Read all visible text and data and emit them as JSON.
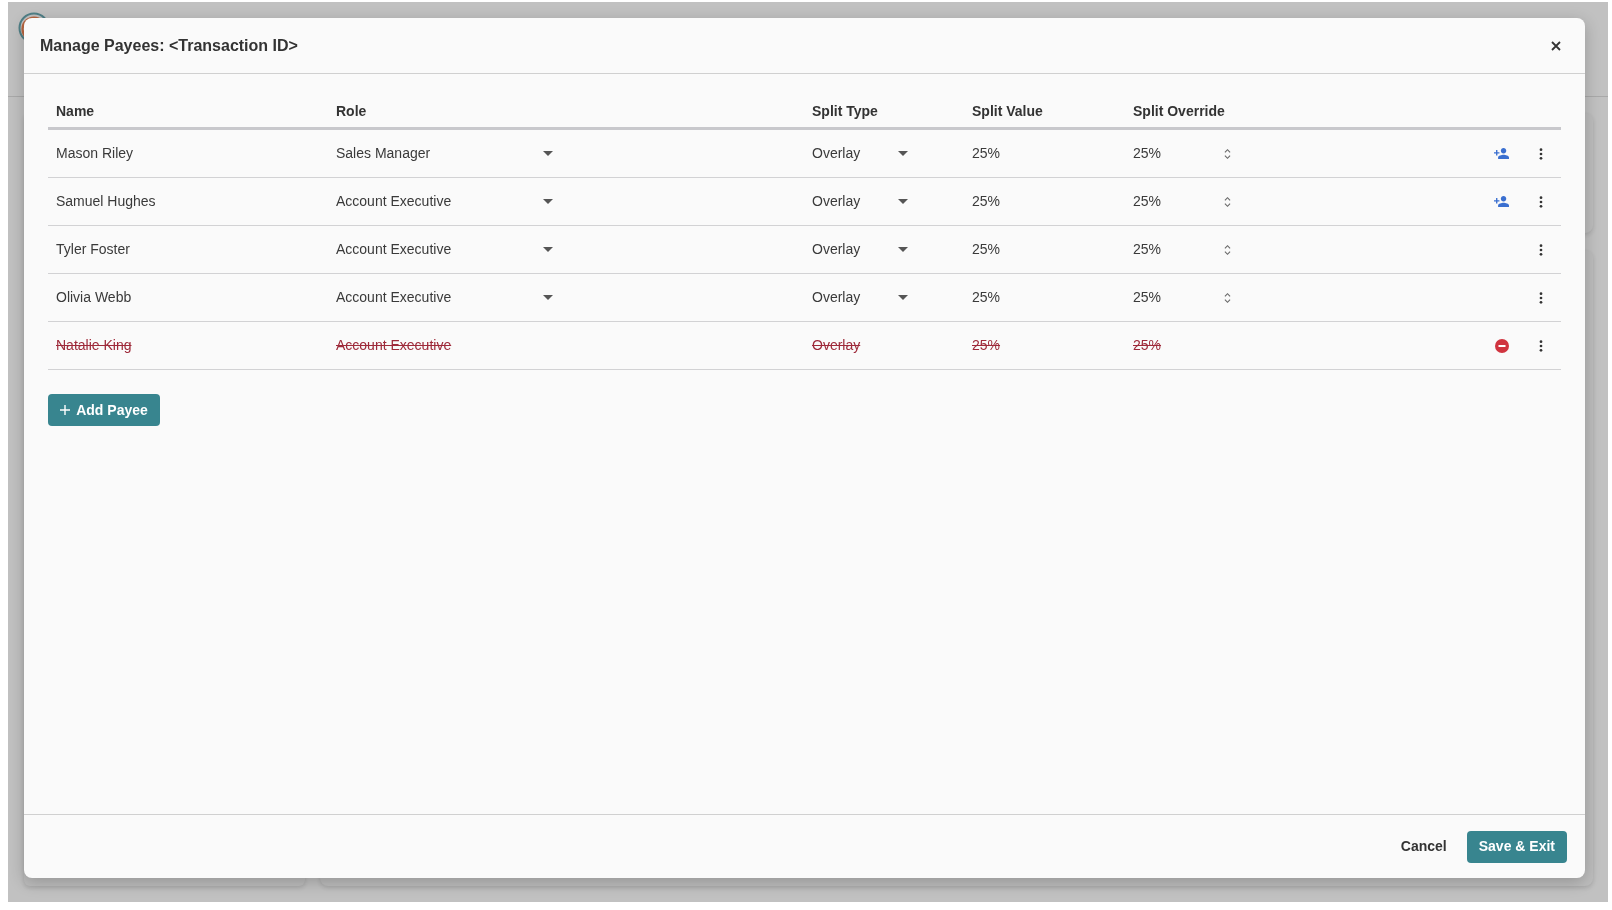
{
  "dialog": {
    "title": "Manage Payees: <Transaction ID>",
    "table": {
      "columns": [
        "Name",
        "Role",
        "Split Type",
        "Split Value",
        "Split Override"
      ],
      "rows": [
        {
          "name": "Mason Riley",
          "role": "Sales Manager",
          "split_type": "Overlay",
          "split_value": "25%",
          "split_override": "25%",
          "removed": false,
          "add_user_action": true
        },
        {
          "name": "Samuel Hughes",
          "role": "Account Executive",
          "split_type": "Overlay",
          "split_value": "25%",
          "split_override": "25%",
          "removed": false,
          "add_user_action": true
        },
        {
          "name": "Tyler Foster",
          "role": "Account Executive",
          "split_type": "Overlay",
          "split_value": "25%",
          "split_override": "25%",
          "removed": false,
          "add_user_action": false
        },
        {
          "name": "Olivia Webb",
          "role": "Account Executive",
          "split_type": "Overlay",
          "split_value": "25%",
          "split_override": "25%",
          "removed": false,
          "add_user_action": false
        },
        {
          "name": "Natalie King",
          "role": "Account Executive",
          "split_type": "Overlay",
          "split_value": "25%",
          "split_override": "25%",
          "removed": true,
          "add_user_action": false
        }
      ]
    },
    "add_button": {
      "label": "Add Payee"
    },
    "footer_buttons": [
      {
        "label": "Cancel",
        "kind": "text"
      },
      {
        "label": "Save & Exit",
        "kind": "primary"
      }
    ]
  }
}
